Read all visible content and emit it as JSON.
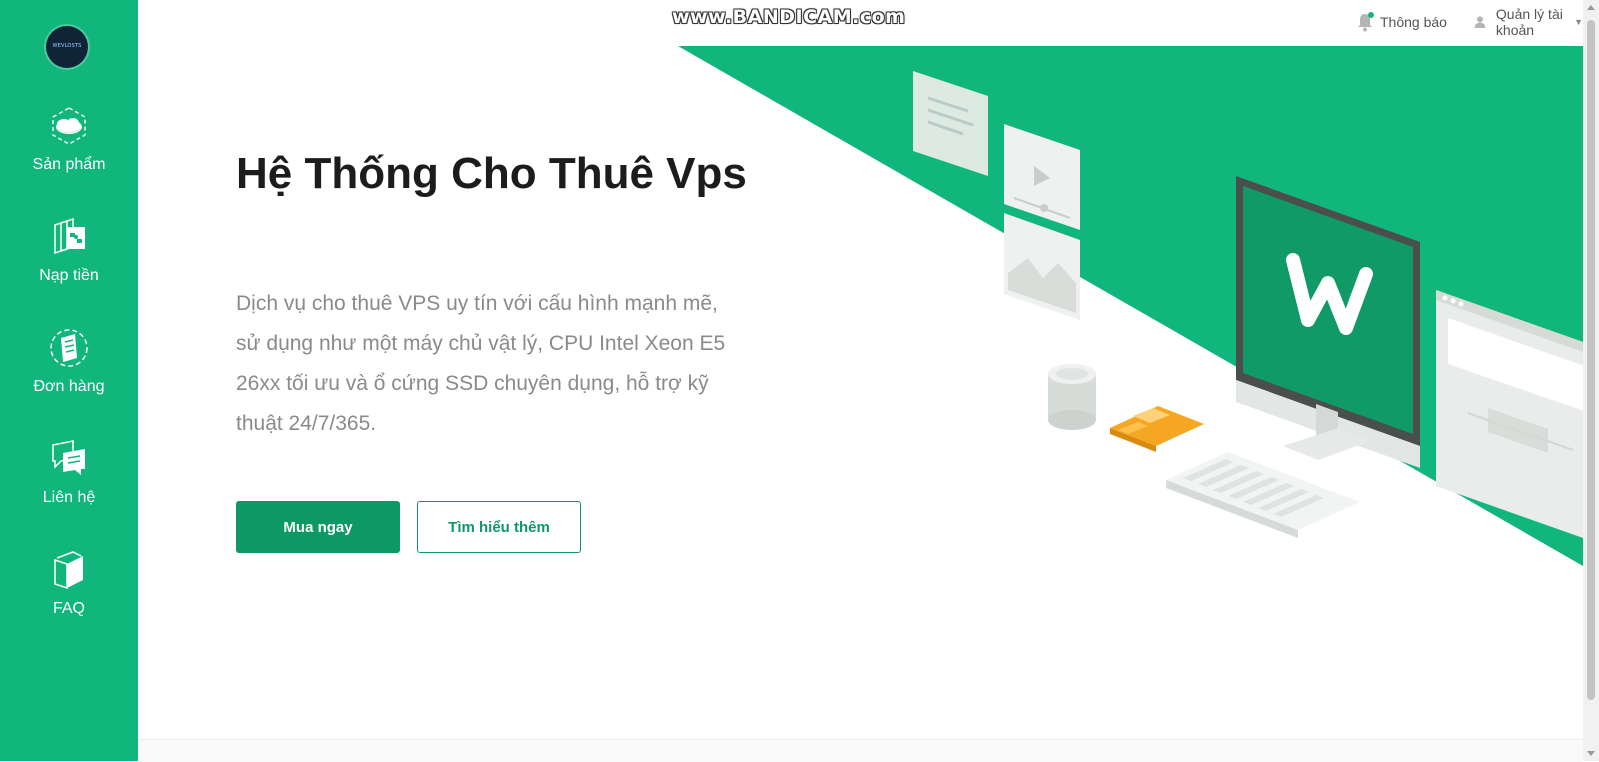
{
  "app": {
    "logo_text": "WEVLOSTS",
    "watermark": "www.BANDICAM.com",
    "accent_color": "#10b67c",
    "button_color": "#0e9866"
  },
  "sidebar": {
    "items": [
      {
        "label": "Sản phẩm",
        "icon": "cloud-box-icon"
      },
      {
        "label": "Nạp tiền",
        "icon": "deposit-icon"
      },
      {
        "label": "Đơn hàng",
        "icon": "order-document-icon"
      },
      {
        "label": "Liên hệ",
        "icon": "chat-contact-icon"
      },
      {
        "label": "FAQ",
        "icon": "book-icon"
      }
    ]
  },
  "header": {
    "notification_label": "Thông báo",
    "account_label": "Quản lý tài khoản",
    "icons": [
      "bell-icon",
      "user-icon",
      "caret-down-icon"
    ]
  },
  "hero": {
    "title": "Hệ Thống Cho Thuê Vps",
    "description": "Dịch vụ cho thuê VPS uy tín với cấu hình mạnh mẽ, sử dụng như một máy chủ vật lý, CPU Intel Xeon E5 26xx tối ưu và ổ cứng SSD chuyên dụng, hỗ trợ kỹ thuật 24/7/365.",
    "buy_button": "Mua ngay",
    "learn_more_button": "Tìm hiểu thêm",
    "illustration": "computer-desk-illustration"
  }
}
